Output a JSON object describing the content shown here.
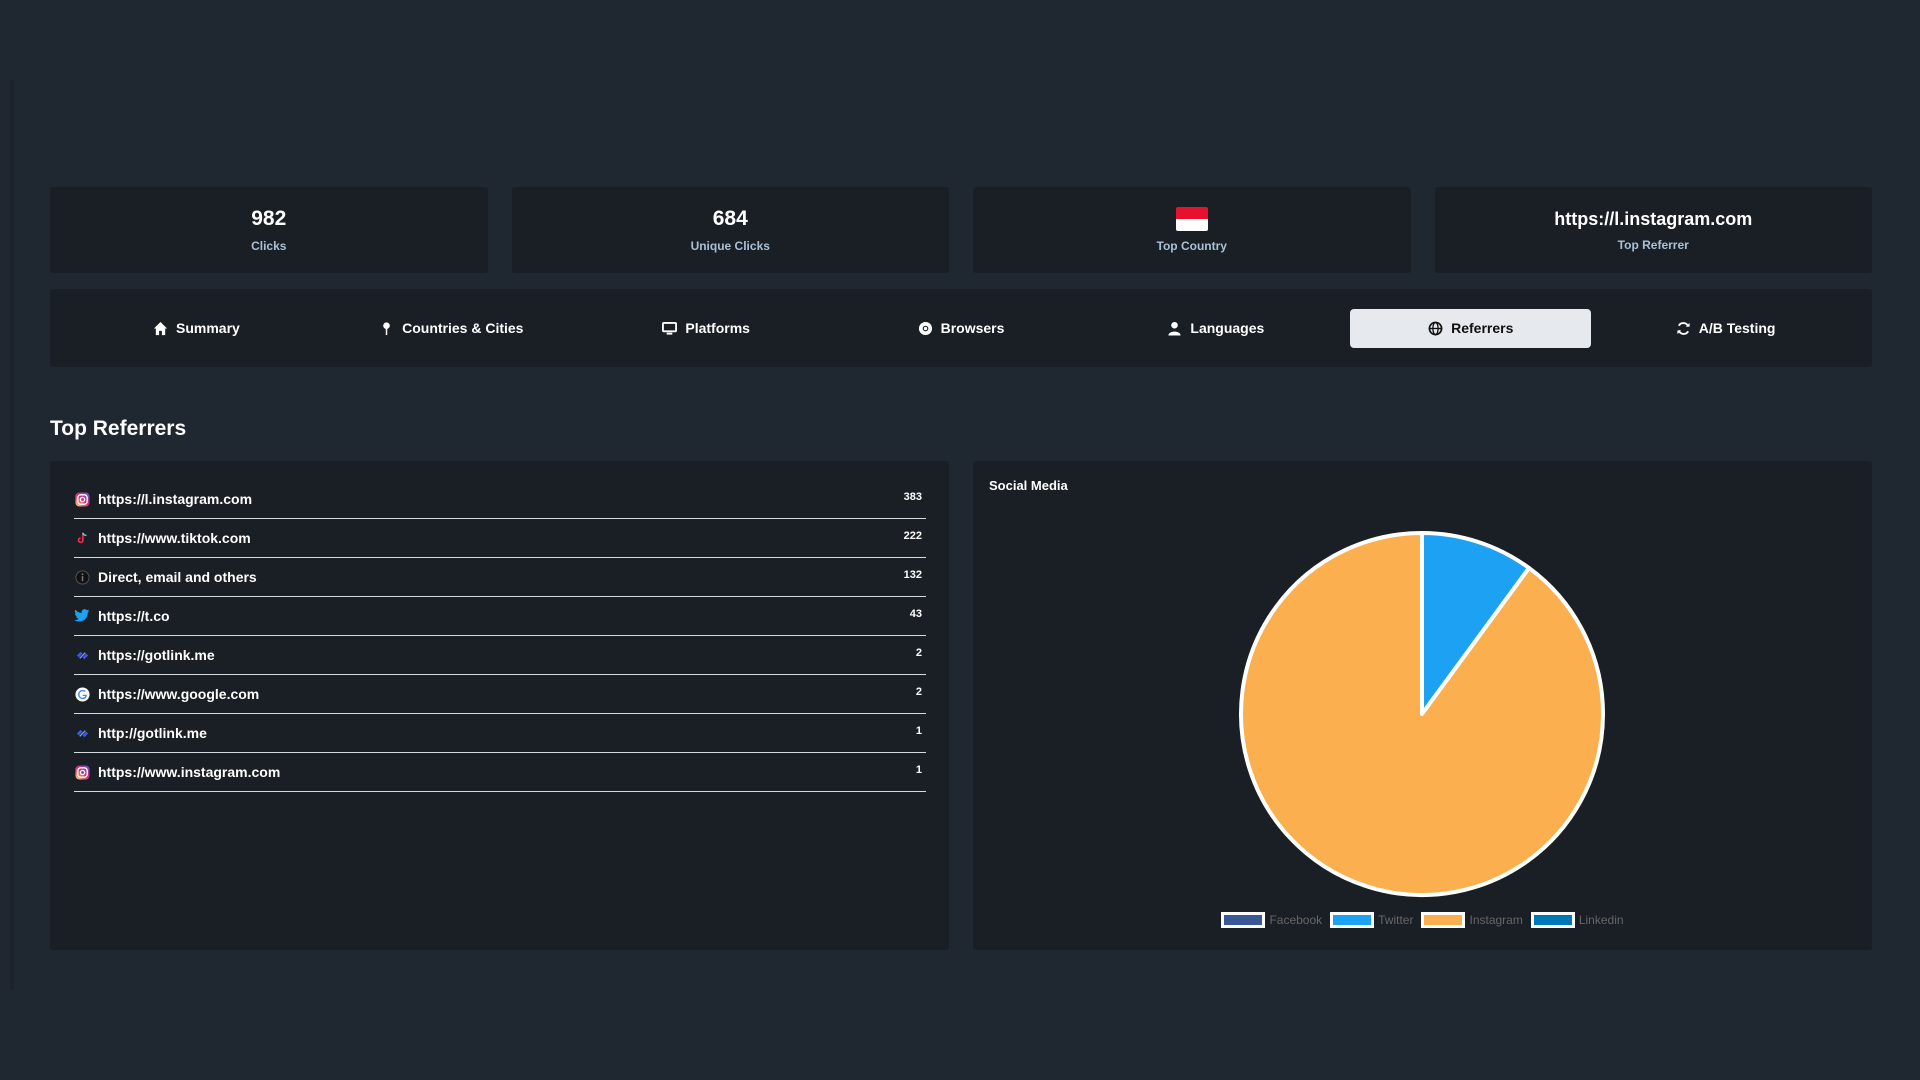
{
  "stats": [
    {
      "value": "982",
      "label": "Clicks"
    },
    {
      "value": "684",
      "label": "Unique Clicks"
    },
    {
      "value": "",
      "label": "Top Country"
    },
    {
      "value": "https://l.instagram.com",
      "label": "Top Referrer"
    }
  ],
  "tabs": [
    {
      "label": "Summary",
      "icon": "home-icon"
    },
    {
      "label": "Countries & Cities",
      "icon": "map-pin-icon"
    },
    {
      "label": "Platforms",
      "icon": "desktop-icon"
    },
    {
      "label": "Browsers",
      "icon": "chrome-icon"
    },
    {
      "label": "Languages",
      "icon": "user-icon"
    },
    {
      "label": "Referrers",
      "icon": "globe-icon",
      "active": true
    },
    {
      "label": "A/B Testing",
      "icon": "sync-icon"
    }
  ],
  "section_title": "Top Referrers",
  "referrers": [
    {
      "name": "https://l.instagram.com",
      "count": "383",
      "icon": "instagram-icon"
    },
    {
      "name": "https://www.tiktok.com",
      "count": "222",
      "icon": "tiktok-icon"
    },
    {
      "name": "Direct, email and others",
      "count": "132",
      "icon": "info-icon"
    },
    {
      "name": "https://t.co",
      "count": "43",
      "icon": "twitter-icon"
    },
    {
      "name": "https://gotlink.me",
      "count": "2",
      "icon": "gotlink-icon"
    },
    {
      "name": "https://www.google.com",
      "count": "2",
      "icon": "google-icon"
    },
    {
      "name": "http://gotlink.me",
      "count": "1",
      "icon": "gotlink-icon"
    },
    {
      "name": "https://www.instagram.com",
      "count": "1",
      "icon": "instagram-icon"
    }
  ],
  "chart_data": {
    "type": "pie",
    "title": "Social Media",
    "categories": [
      "Facebook",
      "Twitter",
      "Instagram",
      "Linkedin"
    ],
    "values": [
      0,
      43,
      384,
      0
    ],
    "colors": [
      "#3b5998",
      "#1da1f2",
      "#fcaf4f",
      "#0077b5"
    ],
    "legend": "bottom"
  },
  "colors": {
    "background": "#1f2730",
    "card": "#1a1f25",
    "label": "#a9c0d6",
    "active_tab": "#e6e9ed"
  }
}
